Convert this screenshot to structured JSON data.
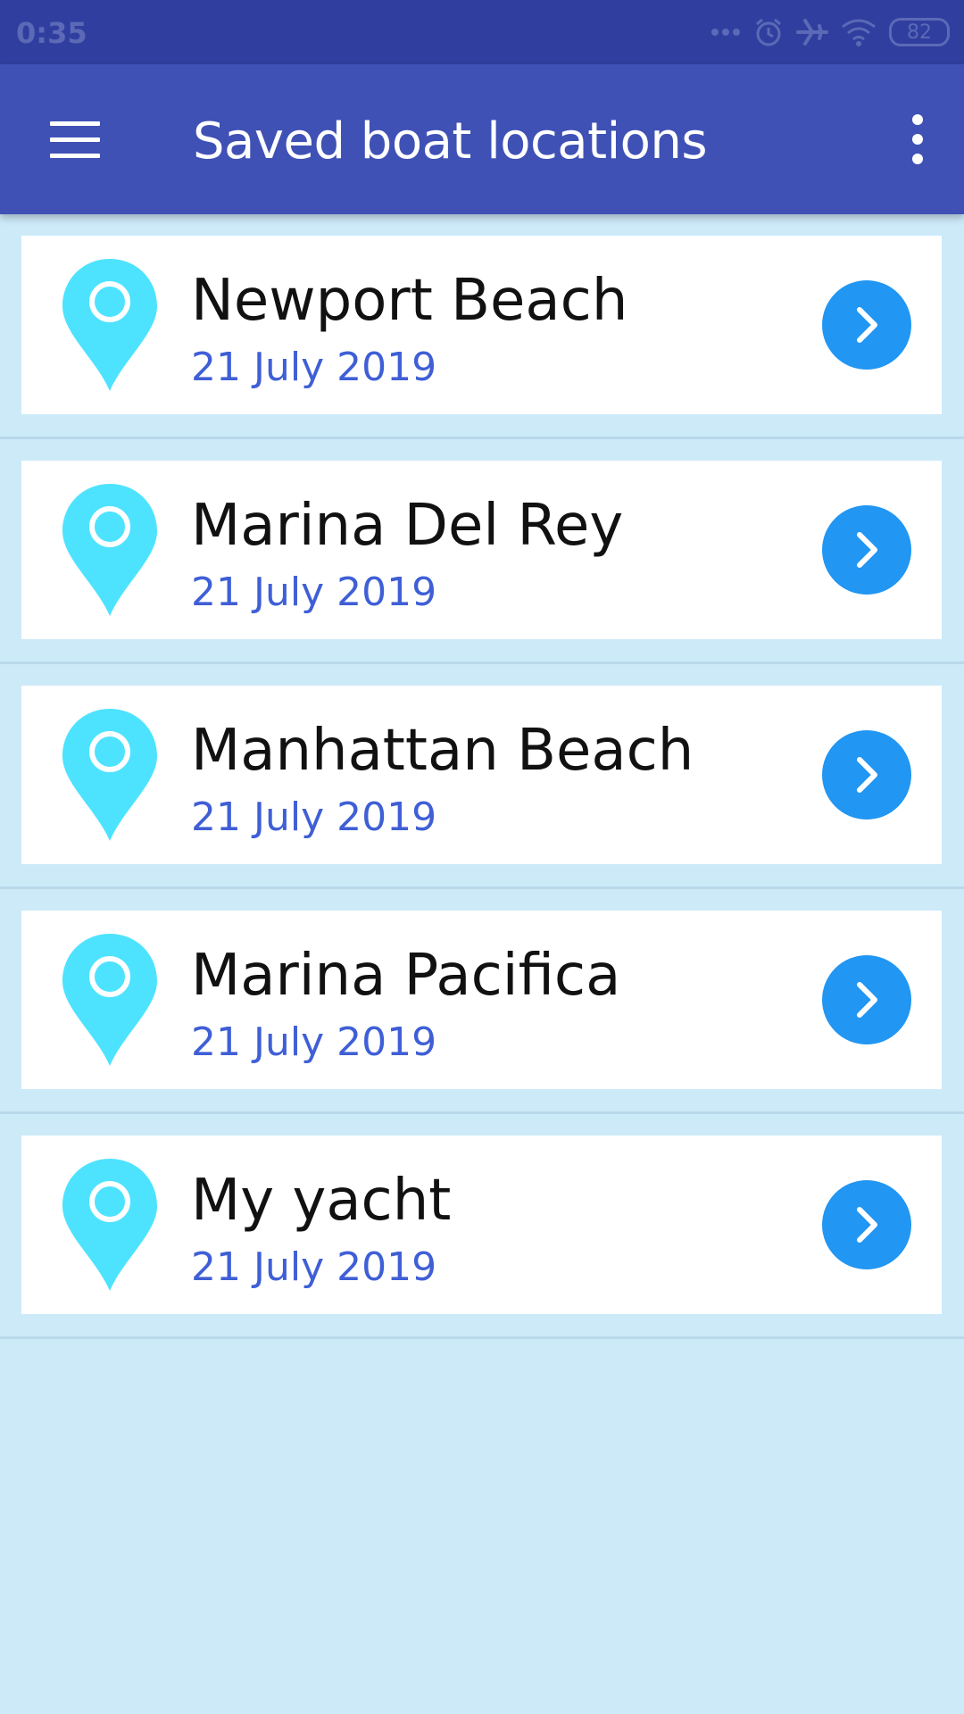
{
  "status_bar": {
    "time": "0:35",
    "battery": "82",
    "icons": [
      "more-dots-icon",
      "alarm-icon",
      "airplane-icon",
      "wifi-icon",
      "battery-icon"
    ]
  },
  "app_bar": {
    "title": "Saved boat locations",
    "menu_icon": "hamburger-menu-icon",
    "overflow_icon": "more-vert-icon"
  },
  "colors": {
    "app_bar": "#3f51b5",
    "status_bar": "#303f9f",
    "background": "#cdeaf9",
    "pin": "#4de3ff",
    "action_button": "#2196f3",
    "date_text": "#3f5fd6"
  },
  "locations": [
    {
      "name": "Newport Beach",
      "date": "21 July 2019"
    },
    {
      "name": "Marina Del Rey",
      "date": "21 July 2019"
    },
    {
      "name": "Manhattan Beach",
      "date": "21 July 2019"
    },
    {
      "name": "Marina Pacifica",
      "date": "21 July 2019"
    },
    {
      "name": "My yacht",
      "date": "21 July 2019"
    }
  ]
}
